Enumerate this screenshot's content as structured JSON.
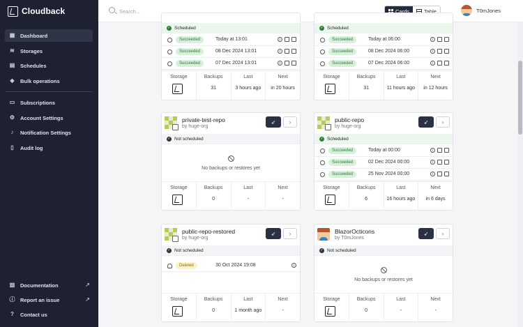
{
  "app": {
    "name": "Cloudback"
  },
  "sidebar": {
    "main": [
      {
        "label": "Dashboard",
        "icon": "dashboard-icon",
        "active": true
      },
      {
        "label": "Storages",
        "icon": "database-icon"
      },
      {
        "label": "Schedules",
        "icon": "calendar-icon"
      },
      {
        "label": "Bulk operations",
        "icon": "layers-icon"
      }
    ],
    "account": [
      {
        "label": "Subscriptions",
        "icon": "credit-card-icon"
      },
      {
        "label": "Account Settings",
        "icon": "gear-icon"
      },
      {
        "label": "Notification Settings",
        "icon": "bell-icon"
      },
      {
        "label": "Audit log",
        "icon": "file-icon"
      }
    ],
    "footer": [
      {
        "label": "Documentation",
        "icon": "book-icon"
      },
      {
        "label": "Report an issue",
        "icon": "alert-icon"
      },
      {
        "label": "Contact us",
        "icon": "help-icon"
      }
    ]
  },
  "topbar": {
    "search_placeholder": "Search...",
    "view_cards": "Cards",
    "view_table": "Table",
    "username": "T0mJones"
  },
  "labels": {
    "scheduled": "Scheduled",
    "not_scheduled": "Not scheduled",
    "empty": "No backups or restores yet",
    "storage": "Storage",
    "backups": "Backups",
    "last": "Last",
    "next": "Next"
  },
  "cards": [
    {
      "runs": [
        {
          "status": "Succeeded",
          "time": "Today at 13:01"
        },
        {
          "status": "Succeeded",
          "time": "08 Dec 2024 13:01"
        },
        {
          "status": "Succeeded",
          "time": "07 Dec 2024 13:01"
        }
      ],
      "backups": "31",
      "last": "3 hours ago",
      "next": "in 20 hours"
    },
    {
      "runs": [
        {
          "status": "Succeeded",
          "time": "Today at 06:00"
        },
        {
          "status": "Succeeded",
          "time": "08 Dec 2024 06:00"
        },
        {
          "status": "Succeeded",
          "time": "07 Dec 2024 06:00"
        }
      ],
      "backups": "31",
      "last": "11 hours ago",
      "next": "in 12 hours"
    },
    {
      "name": "private-test-repo",
      "owner": "by huge-org",
      "backups": "0",
      "last": "-",
      "next": "-"
    },
    {
      "name": "public-repo",
      "owner": "by huge-org",
      "runs": [
        {
          "status": "Succeeded",
          "time": "Today at 00:00"
        },
        {
          "status": "Succeeded",
          "time": "02 Dec 2024 00:00"
        },
        {
          "status": "Succeeded",
          "time": "25 Nov 2024 00:00"
        }
      ],
      "backups": "6",
      "last": "16 hours ago",
      "next": "in 6 days"
    },
    {
      "name": "public-repo-restored",
      "owner": "by huge-org",
      "runs": [
        {
          "status": "Deleted",
          "time": "30 Oct 2024 19:08"
        }
      ],
      "backups": "0",
      "last": "1 month ago",
      "next": "-"
    },
    {
      "name": "BlazorOcticons",
      "owner": "by T0mJones",
      "backups": "0",
      "last": "-",
      "next": "-"
    }
  ],
  "colors": {
    "sidebar": "#1e2230",
    "success": "#2c7a3a",
    "success_bg": "#d7f0da",
    "deleted_bg": "#fdf2c8"
  }
}
